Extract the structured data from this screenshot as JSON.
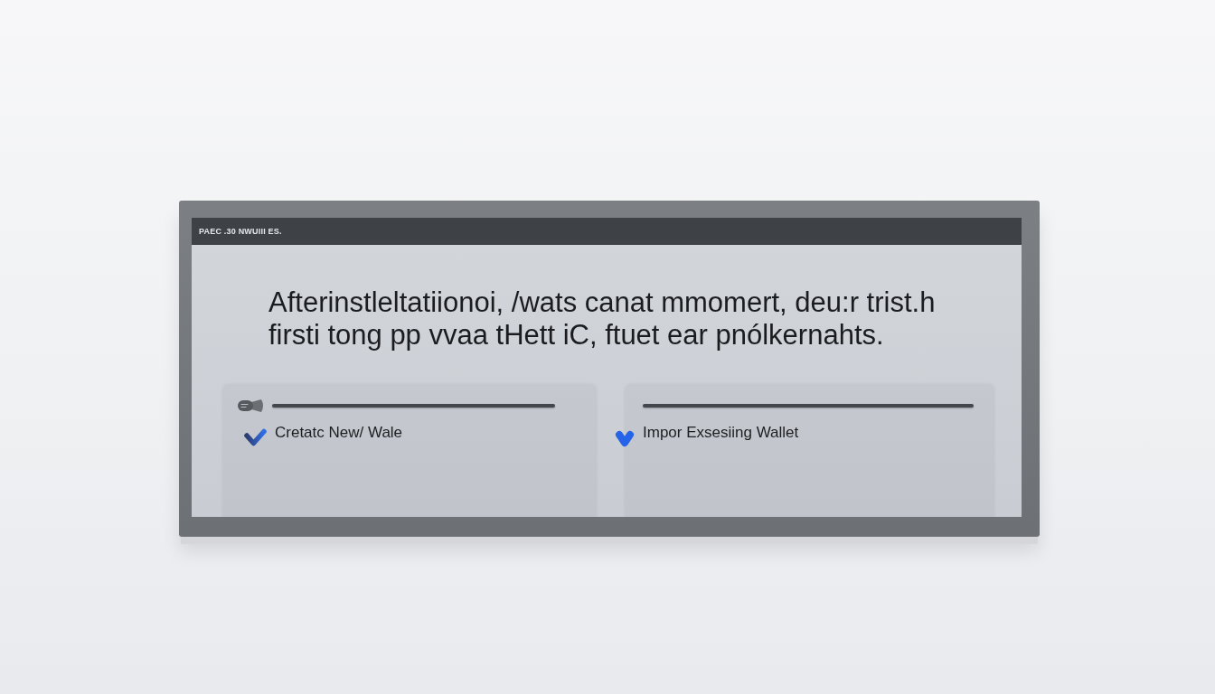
{
  "window": {
    "title": "PAEC .30 NWUIII ES."
  },
  "message": "Afterinstleltatiionoi, /wats canat mmomert, deu:r trist.h\nfirsti tong pp vvaa tHett iC, ftuet ear pnólkernahts.",
  "options": [
    {
      "kind": "create",
      "label": "Cretatc New/ Wale"
    },
    {
      "kind": "import",
      "label": "Impor Exsesiing Wallet"
    }
  ]
}
